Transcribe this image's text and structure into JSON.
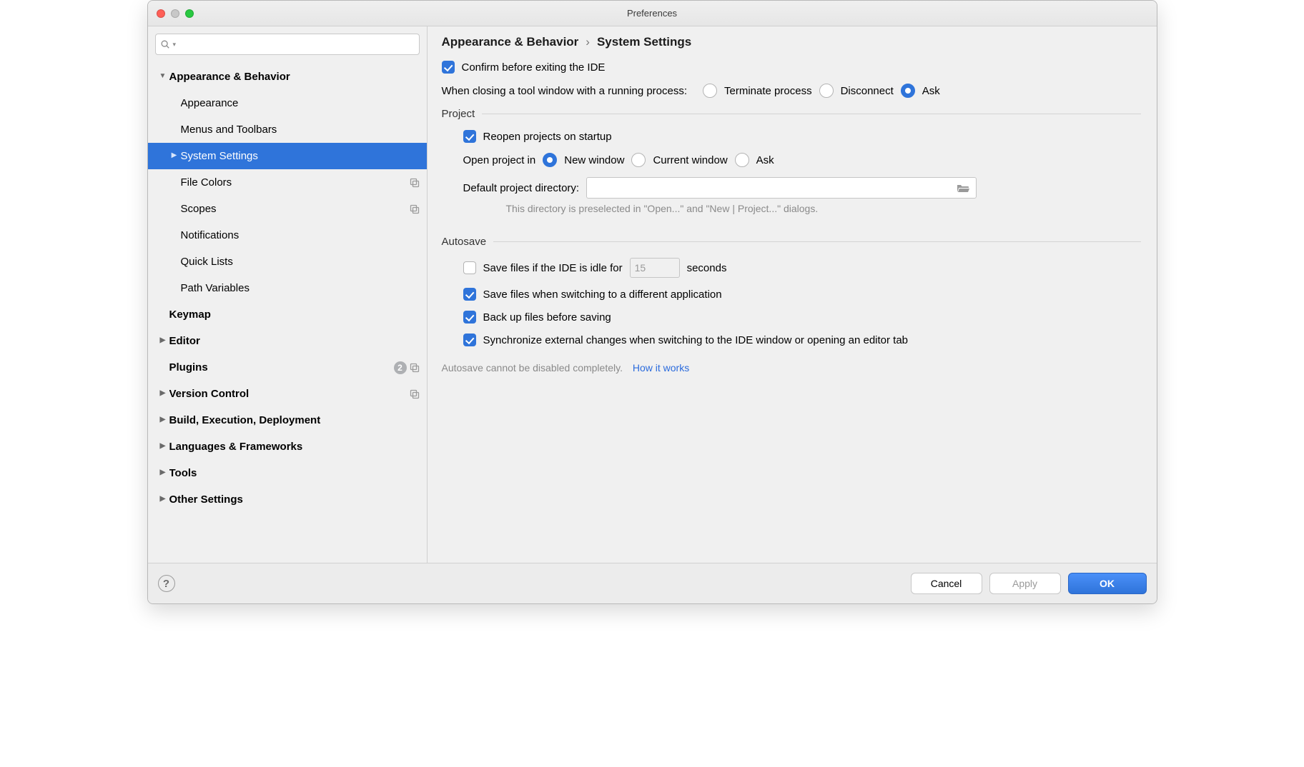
{
  "window": {
    "title": "Preferences"
  },
  "sidebar": {
    "search_placeholder": "",
    "items": [
      {
        "label": "Appearance & Behavior",
        "depth": 0,
        "arrow": "down",
        "sel": false
      },
      {
        "label": "Appearance",
        "depth": 1,
        "arrow": "",
        "sel": false
      },
      {
        "label": "Menus and Toolbars",
        "depth": 1,
        "arrow": "",
        "sel": false
      },
      {
        "label": "System Settings",
        "depth": 1,
        "arrow": "right",
        "sel": true
      },
      {
        "label": "File Colors",
        "depth": 1,
        "arrow": "",
        "sel": false,
        "project": true
      },
      {
        "label": "Scopes",
        "depth": 1,
        "arrow": "",
        "sel": false,
        "project": true
      },
      {
        "label": "Notifications",
        "depth": 1,
        "arrow": "",
        "sel": false
      },
      {
        "label": "Quick Lists",
        "depth": 1,
        "arrow": "",
        "sel": false
      },
      {
        "label": "Path Variables",
        "depth": 1,
        "arrow": "",
        "sel": false
      },
      {
        "label": "Keymap",
        "depth": 0,
        "arrow": "",
        "sel": false
      },
      {
        "label": "Editor",
        "depth": 0,
        "arrow": "right",
        "sel": false
      },
      {
        "label": "Plugins",
        "depth": 0,
        "arrow": "",
        "sel": false,
        "badge": "2",
        "project": true
      },
      {
        "label": "Version Control",
        "depth": 0,
        "arrow": "right",
        "sel": false,
        "project": true
      },
      {
        "label": "Build, Execution, Deployment",
        "depth": 0,
        "arrow": "right",
        "sel": false
      },
      {
        "label": "Languages & Frameworks",
        "depth": 0,
        "arrow": "right",
        "sel": false
      },
      {
        "label": "Tools",
        "depth": 0,
        "arrow": "right",
        "sel": false
      },
      {
        "label": "Other Settings",
        "depth": 0,
        "arrow": "right",
        "sel": false
      }
    ]
  },
  "breadcrumb": {
    "parent": "Appearance & Behavior",
    "sep": "›",
    "current": "System Settings"
  },
  "confirm_exit": {
    "checked": true,
    "label": "Confirm before exiting the IDE"
  },
  "closing_tool": {
    "label": "When closing a tool window with a running process:",
    "options": [
      {
        "label": "Terminate process",
        "checked": false
      },
      {
        "label": "Disconnect",
        "checked": false
      },
      {
        "label": "Ask",
        "checked": true
      }
    ]
  },
  "project": {
    "section": "Project",
    "reopen": {
      "label": "Reopen projects on startup",
      "checked": true
    },
    "open_in": {
      "label": "Open project in",
      "options": [
        {
          "label": "New window",
          "checked": true
        },
        {
          "label": "Current window",
          "checked": false
        },
        {
          "label": "Ask",
          "checked": false
        }
      ]
    },
    "dir": {
      "label": "Default project directory:",
      "value": "",
      "hint": "This directory is preselected in \"Open...\" and \"New | Project...\" dialogs."
    }
  },
  "autosave": {
    "section": "Autosave",
    "idle": {
      "checked": false,
      "label_before": "Save files if the IDE is idle for",
      "value": "15",
      "label_after": "seconds"
    },
    "switch_app": {
      "checked": true,
      "label": "Save files when switching to a different application"
    },
    "backup": {
      "checked": true,
      "label": "Back up files before saving"
    },
    "sync": {
      "checked": true,
      "label": "Synchronize external changes when switching to the IDE window or opening an editor tab"
    },
    "note": "Autosave cannot be disabled completely.",
    "link": "How it works"
  },
  "footer": {
    "cancel": "Cancel",
    "apply": "Apply",
    "ok": "OK"
  }
}
